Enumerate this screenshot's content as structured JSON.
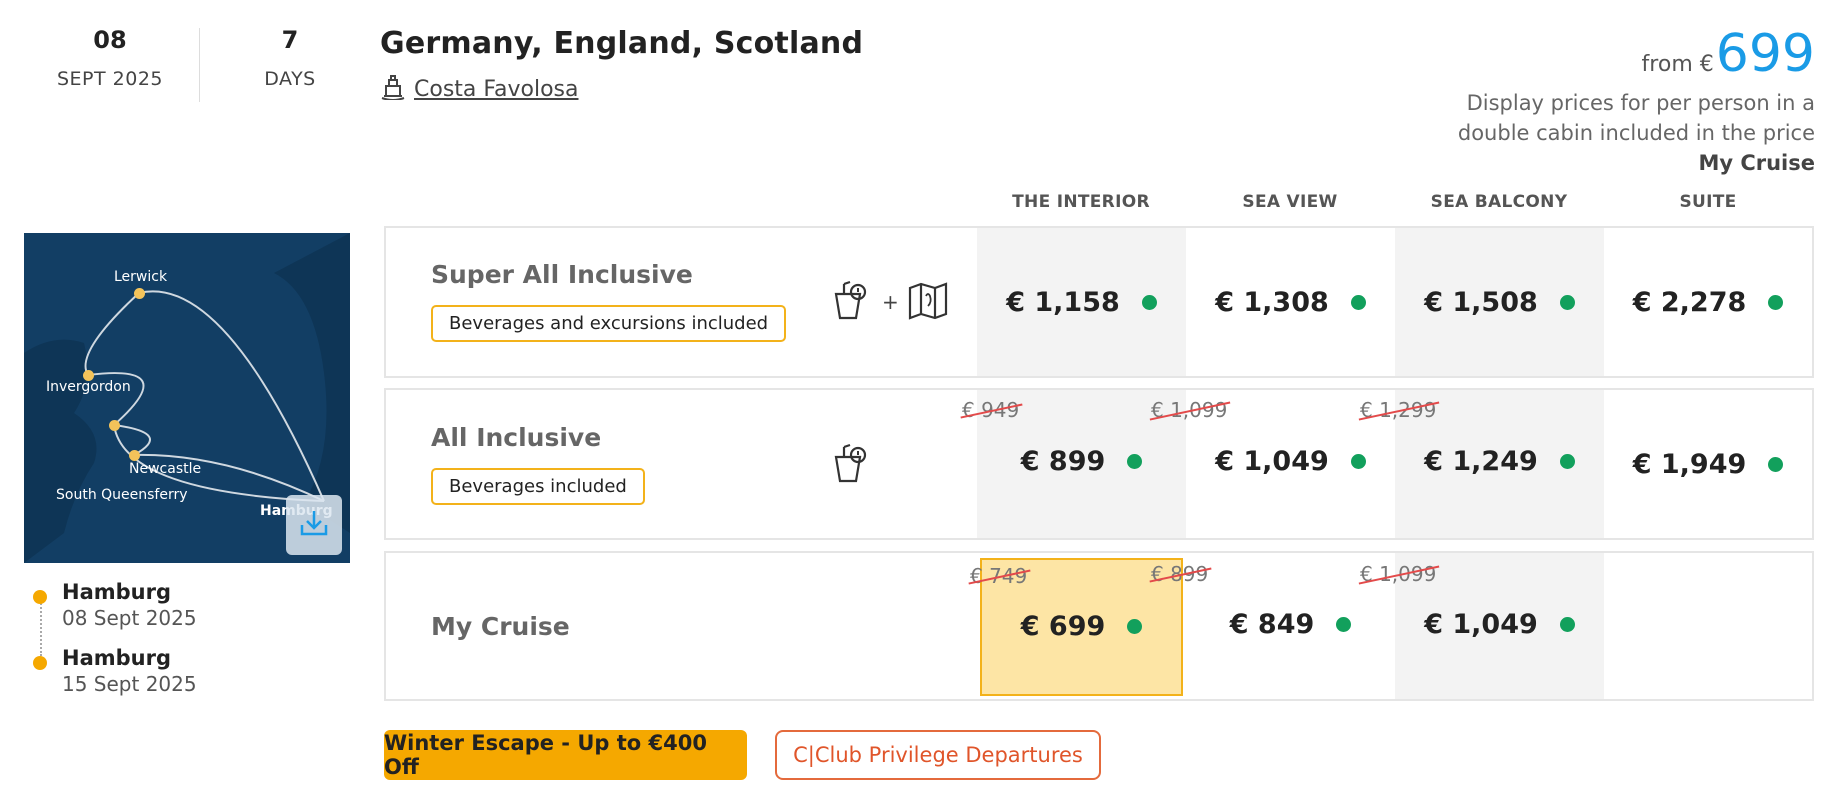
{
  "header": {
    "day": "08",
    "month_year": "SEPT 2025",
    "duration": "7",
    "duration_unit": "DAYS",
    "title": "Germany, England, Scotland",
    "ship": "Costa Favolosa",
    "from_label": "from €",
    "from_price": "699",
    "note_line1": "Display prices for per person in a",
    "note_line2": "double cabin included in the price",
    "note_line3": "My Cruise"
  },
  "columns": [
    "THE INTERIOR",
    "SEA VIEW",
    "SEA BALCONY",
    "SUITE"
  ],
  "rows": [
    {
      "name": "Super All Inclusive",
      "tag": "Beverages and excursions included",
      "icons": [
        "drink-icon",
        "map-icon"
      ],
      "plus": "+",
      "prices": [
        {
          "old": "",
          "price": "€ 1,158"
        },
        {
          "old": "",
          "price": "€ 1,308"
        },
        {
          "old": "",
          "price": "€ 1,508"
        },
        {
          "old": "",
          "price": "€ 2,278"
        }
      ]
    },
    {
      "name": "All Inclusive",
      "tag": "Beverages included",
      "icons": [
        "drink-icon"
      ],
      "prices": [
        {
          "old": "€ 949",
          "price": "€ 899"
        },
        {
          "old": "€ 1,099",
          "price": "€ 1,049"
        },
        {
          "old": "€ 1,299",
          "price": "€ 1,249"
        },
        {
          "old": "",
          "price": "€ 1,949"
        }
      ]
    },
    {
      "name": "My Cruise",
      "tag": "",
      "icons": [],
      "prices": [
        {
          "old": "€ 749",
          "price": "€ 699"
        },
        {
          "old": "€ 899",
          "price": "€ 849"
        },
        {
          "old": "€ 1,099",
          "price": "€ 1,049"
        },
        {
          "old": "",
          "price": ""
        }
      ]
    }
  ],
  "map": {
    "labels": [
      "Lerwick",
      "Invergordon",
      "Newcastle",
      "South Queensferry",
      "Hamburg"
    ]
  },
  "itinerary": [
    {
      "port": "Hamburg",
      "date": "08 Sept 2025"
    },
    {
      "port": "Hamburg",
      "date": "15 Sept 2025"
    }
  ],
  "buttons": {
    "promo": "Winter Escape - Up to €400 Off",
    "club": "C|Club Privilege Departures"
  },
  "colors": {
    "accent_blue": "#1a9be6",
    "accent_yellow": "#f5a800",
    "available_green": "#12a05c",
    "strike_red": "#e34a4a"
  }
}
